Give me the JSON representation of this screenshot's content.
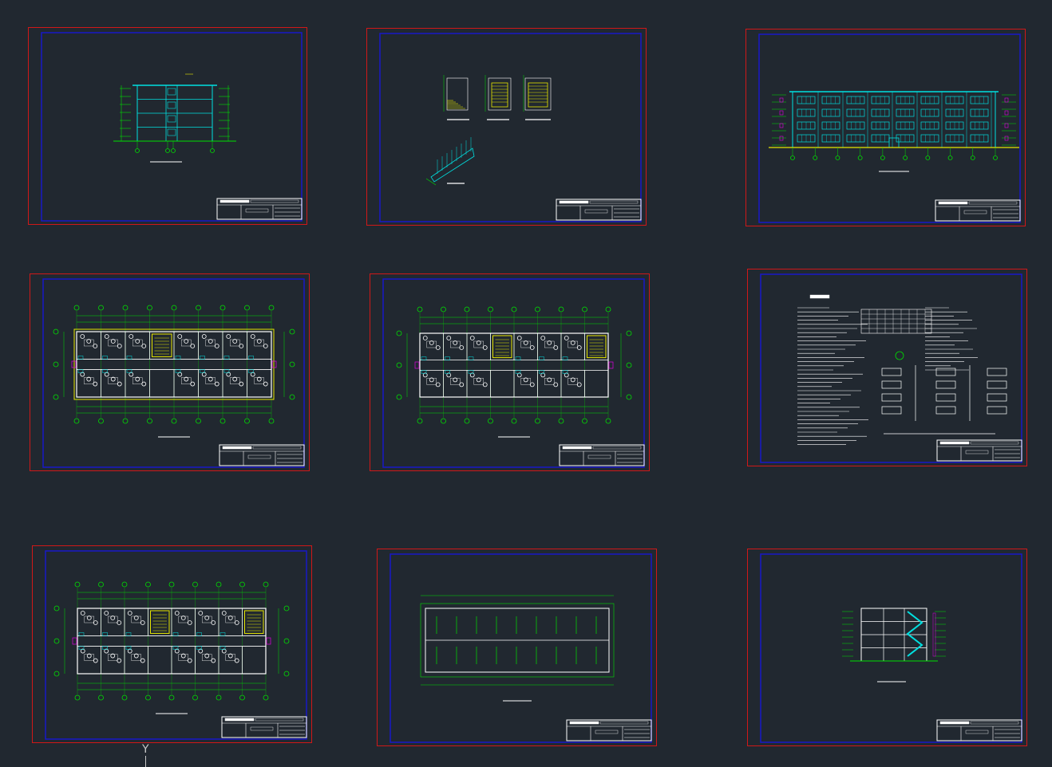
{
  "canvas": {
    "background": "#212830"
  },
  "colors": {
    "sheet_border": "#d01818",
    "inner_frame": "#1818c8",
    "primary_line": "#00e0e0",
    "green_line": "#00e000",
    "yellow_line": "#e6e600",
    "white_line": "#ffffff",
    "magenta_line": "#e000e0"
  },
  "sheets": [
    {
      "id": "side-elevation",
      "kind": "side-elevation"
    },
    {
      "id": "stair-details",
      "kind": "stair-details"
    },
    {
      "id": "front-elevation",
      "kind": "front-elevation"
    },
    {
      "id": "first-floor-plan",
      "kind": "floor-plan"
    },
    {
      "id": "standard-floor-plan",
      "kind": "floor-plan"
    },
    {
      "id": "design-notes",
      "kind": "notes"
    },
    {
      "id": "top-floor-plan",
      "kind": "floor-plan"
    },
    {
      "id": "roof-plan",
      "kind": "roof-plan"
    },
    {
      "id": "section",
      "kind": "section"
    }
  ],
  "ucs": {
    "y_label": "Y"
  }
}
